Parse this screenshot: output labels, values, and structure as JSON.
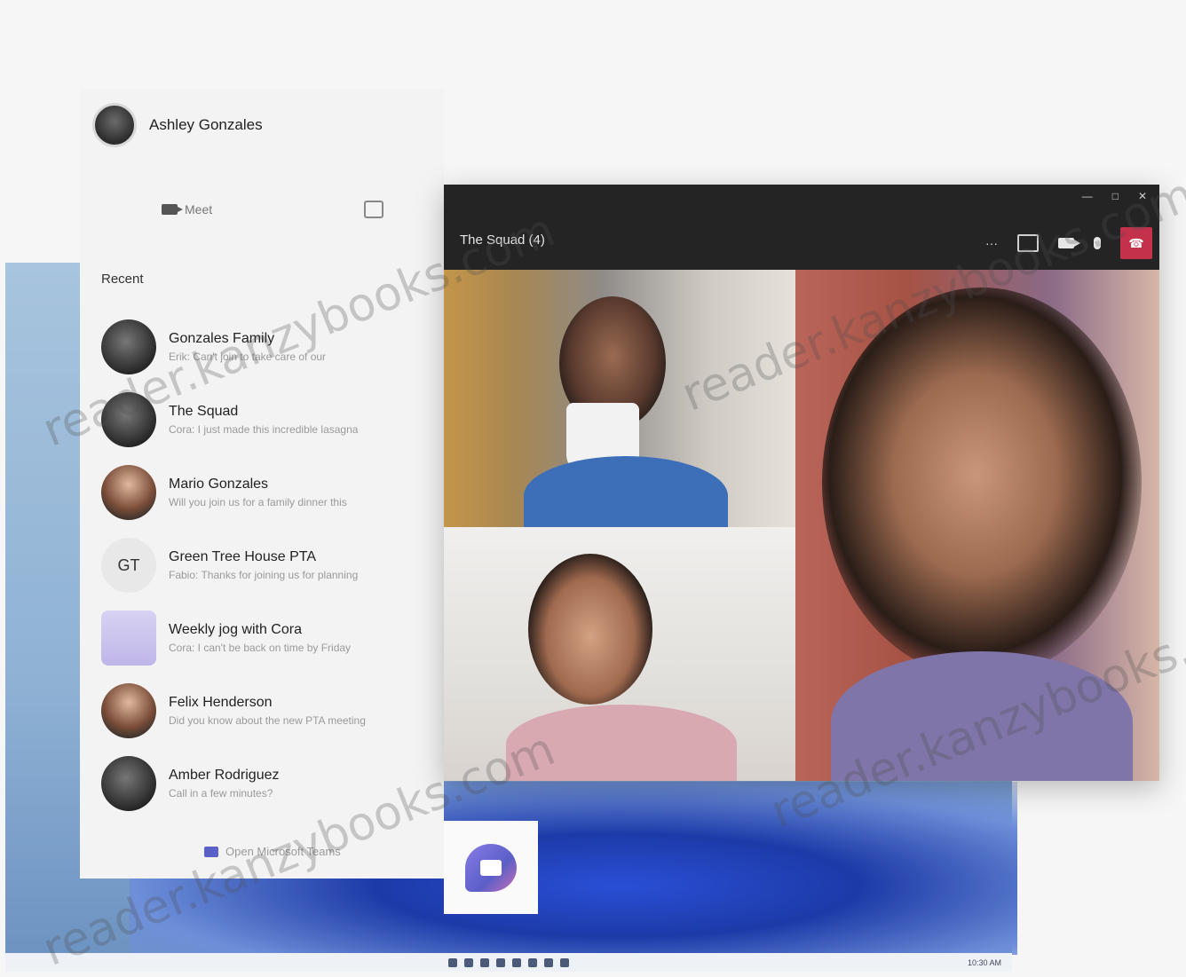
{
  "profile": {
    "name": "Ashley Gonzales"
  },
  "meet": {
    "label": "Meet"
  },
  "recent": {
    "label": "Recent"
  },
  "chats": [
    {
      "name": "Gonzales Family",
      "preview": "Erik: Can't join to take care of our",
      "avatar": "dark",
      "initials": ""
    },
    {
      "name": "The Squad",
      "preview": "Cora: I just made this incredible lasagna",
      "avatar": "dark",
      "initials": ""
    },
    {
      "name": "Mario Gonzales",
      "preview": "Will you join us for a family dinner this",
      "avatar": "face",
      "initials": ""
    },
    {
      "name": "Green Tree House PTA",
      "preview": "Fabio: Thanks for joining us for planning",
      "avatar": "light",
      "initials": "GT"
    },
    {
      "name": "Weekly jog with Cora",
      "preview": "Cora: I can't be back on time by Friday",
      "avatar": "lav",
      "initials": ""
    },
    {
      "name": "Felix Henderson",
      "preview": "Did you know about the new PTA meeting",
      "avatar": "face",
      "initials": ""
    },
    {
      "name": "Amber Rodriguez",
      "preview": "Call in a few minutes?",
      "avatar": "dark",
      "initials": ""
    }
  ],
  "open_teams": {
    "label": "Open Microsoft Teams"
  },
  "call": {
    "title": "The Squad (4)",
    "more_label": "···",
    "window_controls": [
      "—",
      "□",
      "✕"
    ]
  },
  "taskbar": {
    "tray": "10:30 AM"
  },
  "watermark": {
    "text_1": "reader.kanzybooks.com",
    "text_2": "reader.kanzybooks.com",
    "text_3": "reader.kanzybooks.com",
    "text_4": "reader.kanzybooks.com"
  },
  "colors": {
    "teams_purple": "#5b5fc7",
    "hangup_red": "#c4314b",
    "call_bg": "#242424"
  }
}
